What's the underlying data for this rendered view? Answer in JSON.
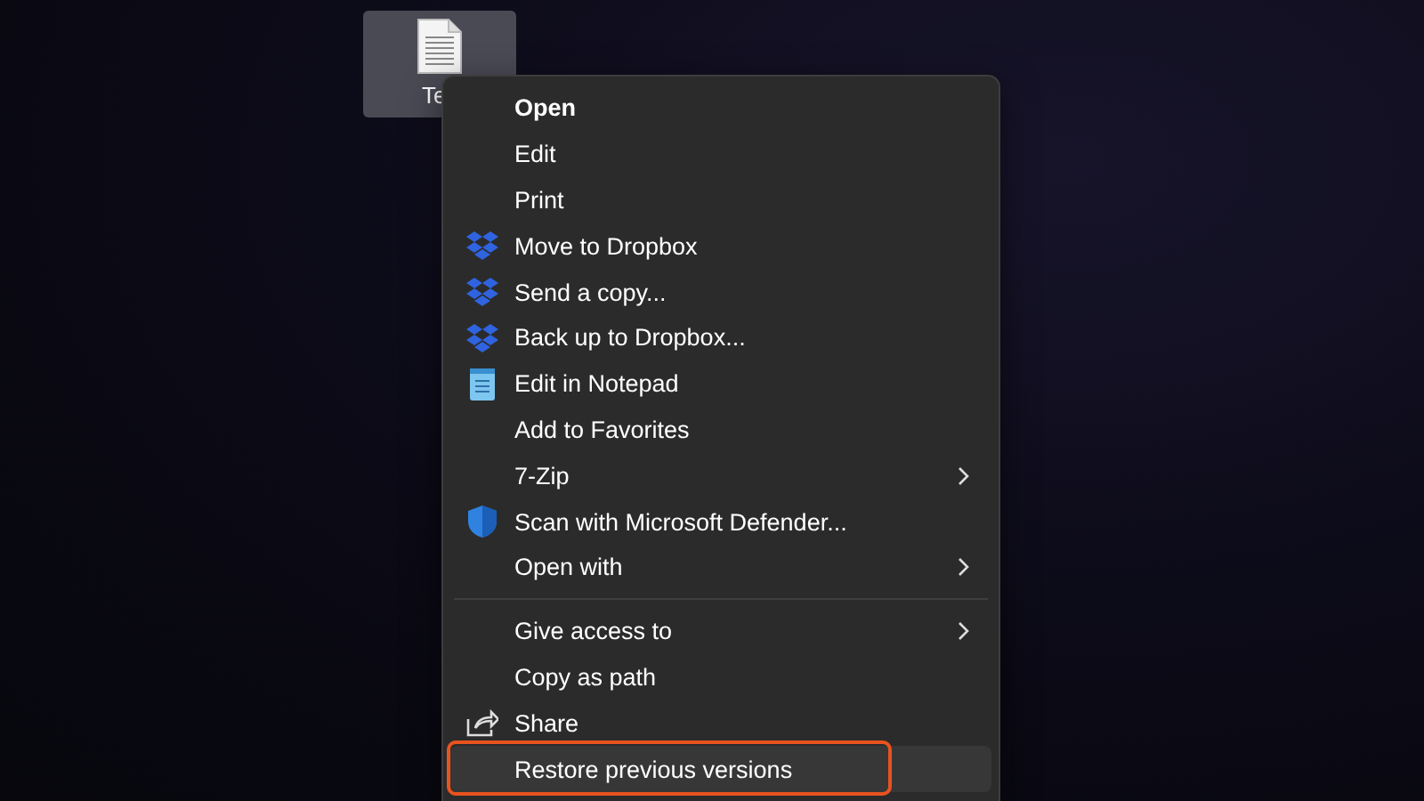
{
  "desktop_icon": {
    "label": "Te",
    "selected": true
  },
  "context_menu": {
    "groups": [
      {
        "items": [
          {
            "label": "Open",
            "kind": "none",
            "default": true,
            "submenu": false,
            "selected": false
          },
          {
            "label": "Edit",
            "kind": "none",
            "default": false,
            "submenu": false,
            "selected": false
          },
          {
            "label": "Print",
            "kind": "none",
            "default": false,
            "submenu": false,
            "selected": false
          },
          {
            "label": "Move to Dropbox",
            "kind": "dropbox",
            "default": false,
            "submenu": false,
            "selected": false
          },
          {
            "label": "Send a copy...",
            "kind": "dropbox",
            "default": false,
            "submenu": false,
            "selected": false
          },
          {
            "label": "Back up to Dropbox...",
            "kind": "dropbox",
            "default": false,
            "submenu": false,
            "selected": false
          },
          {
            "label": "Edit in Notepad",
            "kind": "notepad",
            "default": false,
            "submenu": false,
            "selected": false
          },
          {
            "label": "Add to Favorites",
            "kind": "none",
            "default": false,
            "submenu": false,
            "selected": false
          },
          {
            "label": "7-Zip",
            "kind": "none",
            "default": false,
            "submenu": true,
            "selected": false
          },
          {
            "label": "Scan with Microsoft Defender...",
            "kind": "defender",
            "default": false,
            "submenu": false,
            "selected": false
          },
          {
            "label": "Open with",
            "kind": "none",
            "default": false,
            "submenu": true,
            "selected": false
          }
        ]
      },
      {
        "items": [
          {
            "label": "Give access to",
            "kind": "none",
            "default": false,
            "submenu": true,
            "selected": false
          },
          {
            "label": "Copy as path",
            "kind": "none",
            "default": false,
            "submenu": false,
            "selected": false
          },
          {
            "label": "Share",
            "kind": "share",
            "default": false,
            "submenu": false,
            "selected": false
          },
          {
            "label": "Restore previous versions",
            "kind": "none",
            "default": false,
            "submenu": false,
            "selected": true
          }
        ]
      }
    ]
  }
}
